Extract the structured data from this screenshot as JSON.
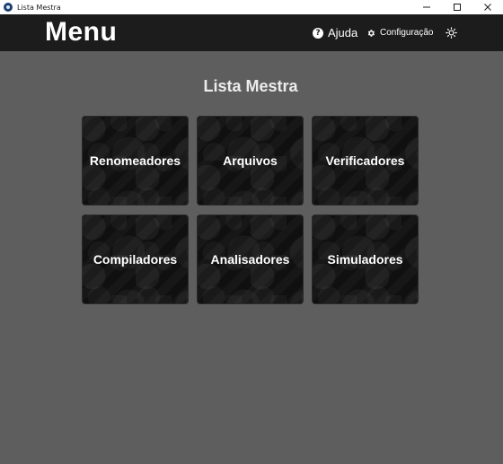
{
  "window": {
    "title": "Lista Mestra"
  },
  "header": {
    "title": "Menu",
    "help_label": "Ajuda",
    "config_label": "Configuração"
  },
  "main": {
    "title": "Lista Mestra",
    "tiles": [
      {
        "label": "Renomeadores"
      },
      {
        "label": "Arquivos"
      },
      {
        "label": "Verificadores"
      },
      {
        "label": "Compiladores"
      },
      {
        "label": "Analisadores"
      },
      {
        "label": "Simuladores"
      }
    ]
  },
  "icons": {
    "app": "app-icon",
    "help": "help-circle-icon",
    "config": "gear-icon",
    "theme": "sun-icon",
    "minimize": "minimize-icon",
    "maximize": "maximize-icon",
    "close": "close-icon"
  },
  "colors": {
    "background": "#5e5e5e",
    "header": "#1c1c1c",
    "tile": "#101010",
    "text": "#ffffff"
  }
}
